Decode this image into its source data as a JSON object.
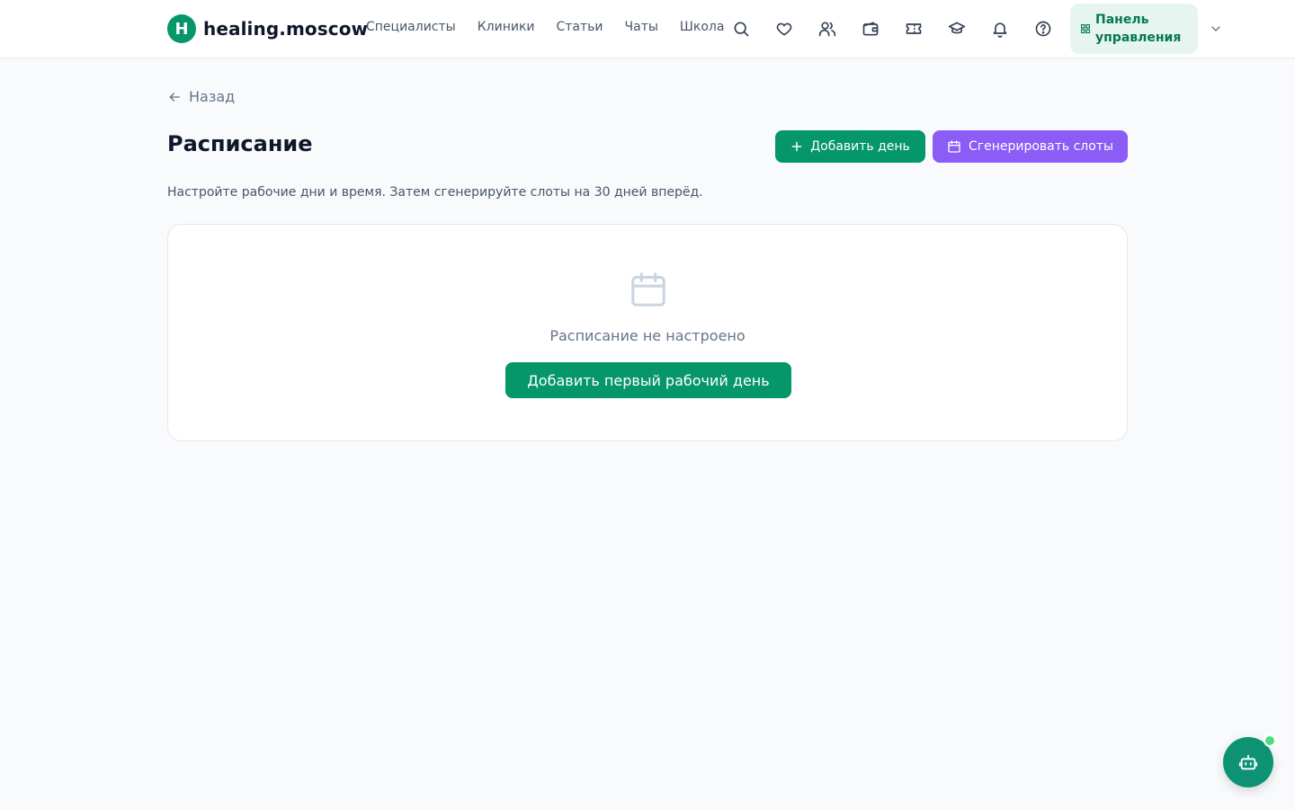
{
  "header": {
    "logo_letter": "H",
    "brand": "healing.moscow",
    "nav": [
      "Специалисты",
      "Клиники",
      "Статьи",
      "Чаты",
      "Школа"
    ],
    "icons": [
      "search-icon",
      "heart-icon",
      "users-icon",
      "wallet-icon",
      "ticket-icon",
      "graduation-cap-icon",
      "bell-icon",
      "help-circle-icon"
    ],
    "panel_label": "Панель управления",
    "accent": "#059669"
  },
  "back_label": "Назад",
  "page": {
    "title": "Расписание",
    "subtitle": "Настройте рабочие дни и время. Затем сгенерируйте слоты на 30 дней вперёд.",
    "add_day_label": "Добавить день",
    "generate_label": "Сгенерировать слоты"
  },
  "empty_state": {
    "text": "Расписание не настроено",
    "button_label": "Добавить первый рабочий день"
  },
  "colors": {
    "primary": "#059669",
    "secondary": "#8b5cf6"
  }
}
